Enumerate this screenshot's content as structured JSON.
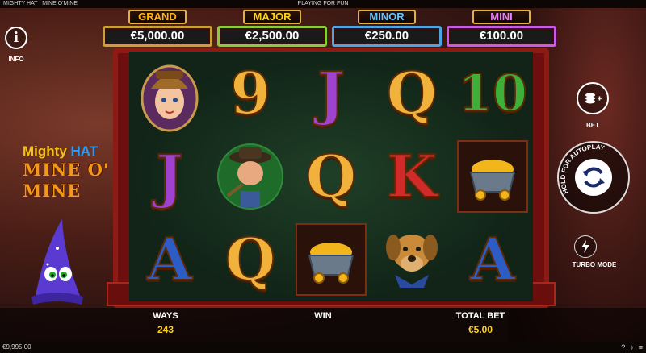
{
  "top_bar": {
    "title": "MIGHTY HAT : MINE O'MINE",
    "mode": "PLAYING FOR FUN"
  },
  "jackpots": [
    {
      "label": "GRAND",
      "value": "€5,000.00",
      "color": "#ffb21a"
    },
    {
      "label": "MAJOR",
      "value": "€2,500.00",
      "color": "#ffd21a"
    },
    {
      "label": "MINOR",
      "value": "€250.00",
      "color": "#69c3ff"
    },
    {
      "label": "MINI",
      "value": "€100.00",
      "color": "#e77dff"
    }
  ],
  "controls": {
    "info_label": "INFO",
    "bet_label": "BET",
    "autoplay_label": "HOLD FOR AUTOPLAY",
    "turbo_label": "TURBO MODE"
  },
  "logo": {
    "line1a": "Mighty",
    "line1b": "HAT",
    "line2": "MINE O'",
    "line3": "MINE"
  },
  "reels": [
    [
      "miner-woman",
      "9",
      "J",
      "Q",
      "10"
    ],
    [
      "J",
      "old-miner",
      "Q",
      "K",
      "gold-cart"
    ],
    [
      "A",
      "Q",
      "gold-cart",
      "dog",
      "A"
    ]
  ],
  "stats": {
    "ways_label": "WAYS",
    "ways_value": "243",
    "win_label": "WIN",
    "total_bet_label": "TOTAL BET",
    "total_bet_value": "€5.00"
  },
  "status": {
    "balance": "€9,995.00"
  }
}
